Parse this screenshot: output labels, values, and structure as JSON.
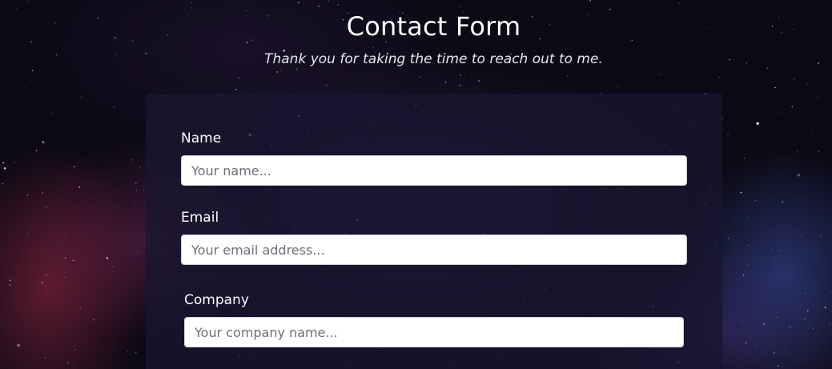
{
  "header": {
    "title": "Contact Form",
    "subtitle": "Thank you for taking the time to reach out to me."
  },
  "form": {
    "fields": [
      {
        "label": "Name",
        "placeholder": "Your name...",
        "value": ""
      },
      {
        "label": "Email",
        "placeholder": "Your email address...",
        "value": ""
      },
      {
        "label": "Company",
        "placeholder": "Your company name...",
        "value": ""
      }
    ]
  },
  "colors": {
    "background": "#0b0914",
    "card": "#181630",
    "text": "#ffffff",
    "input_bg": "#ffffff",
    "placeholder": "#6b6f76"
  }
}
